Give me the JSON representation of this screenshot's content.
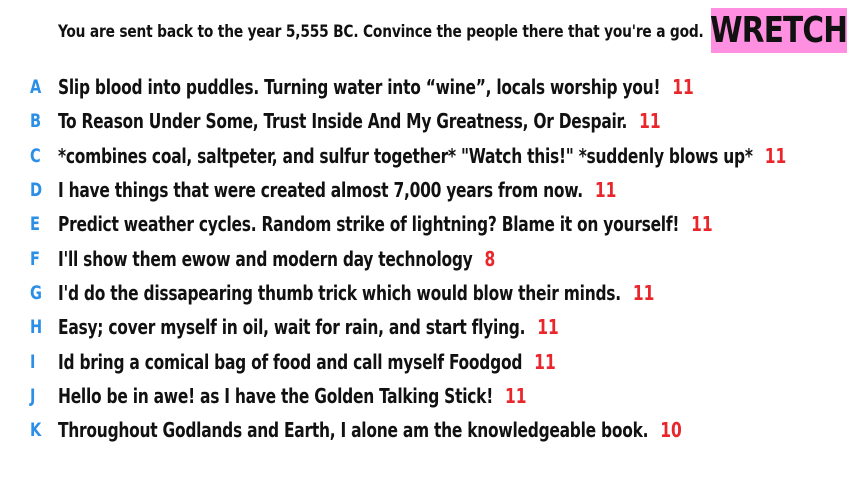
{
  "prompt": "You are sent back to the year 5,555 BC. Convince the people there that you're a god.",
  "logo": "WRETCH",
  "colors": {
    "letter": "#2b8fe6",
    "score": "#e8262b",
    "logo_bg": "#ff8fe0"
  },
  "answers": [
    {
      "letter": "A",
      "text": "Slip blood into puddles. Turning water into “wine”, locals worship you!",
      "score": "11"
    },
    {
      "letter": "B",
      "text": "To Reason Under Some, Trust Inside And My Greatness, Or Despair.",
      "score": "11"
    },
    {
      "letter": "C",
      "text": "*combines coal, saltpeter, and sulfur together* \"Watch this!\" *suddenly blows up*",
      "score": "11"
    },
    {
      "letter": "D",
      "text": "I have things that were created almost 7,000 years from now.",
      "score": "11"
    },
    {
      "letter": "E",
      "text": "Predict weather cycles. Random strike of lightning? Blame it on yourself!",
      "score": "11"
    },
    {
      "letter": "F",
      "text": "I'll show them ewow and modern day technology",
      "score": "8"
    },
    {
      "letter": "G",
      "text": "I'd do the dissapearing thumb trick which would blow their minds.",
      "score": "11"
    },
    {
      "letter": "H",
      "text": "Easy; cover myself in oil, wait for rain, and start flying.",
      "score": "11"
    },
    {
      "letter": "I",
      "text": "Id bring a comical bag of food and call myself  Foodgod",
      "score": "11"
    },
    {
      "letter": "J",
      "text": "Hello be in awe! as I have the Golden Talking Stick!",
      "score": "11"
    },
    {
      "letter": "K",
      "text": "Throughout Godlands and Earth, I alone am the knowledgeable book.",
      "score": "10"
    }
  ]
}
